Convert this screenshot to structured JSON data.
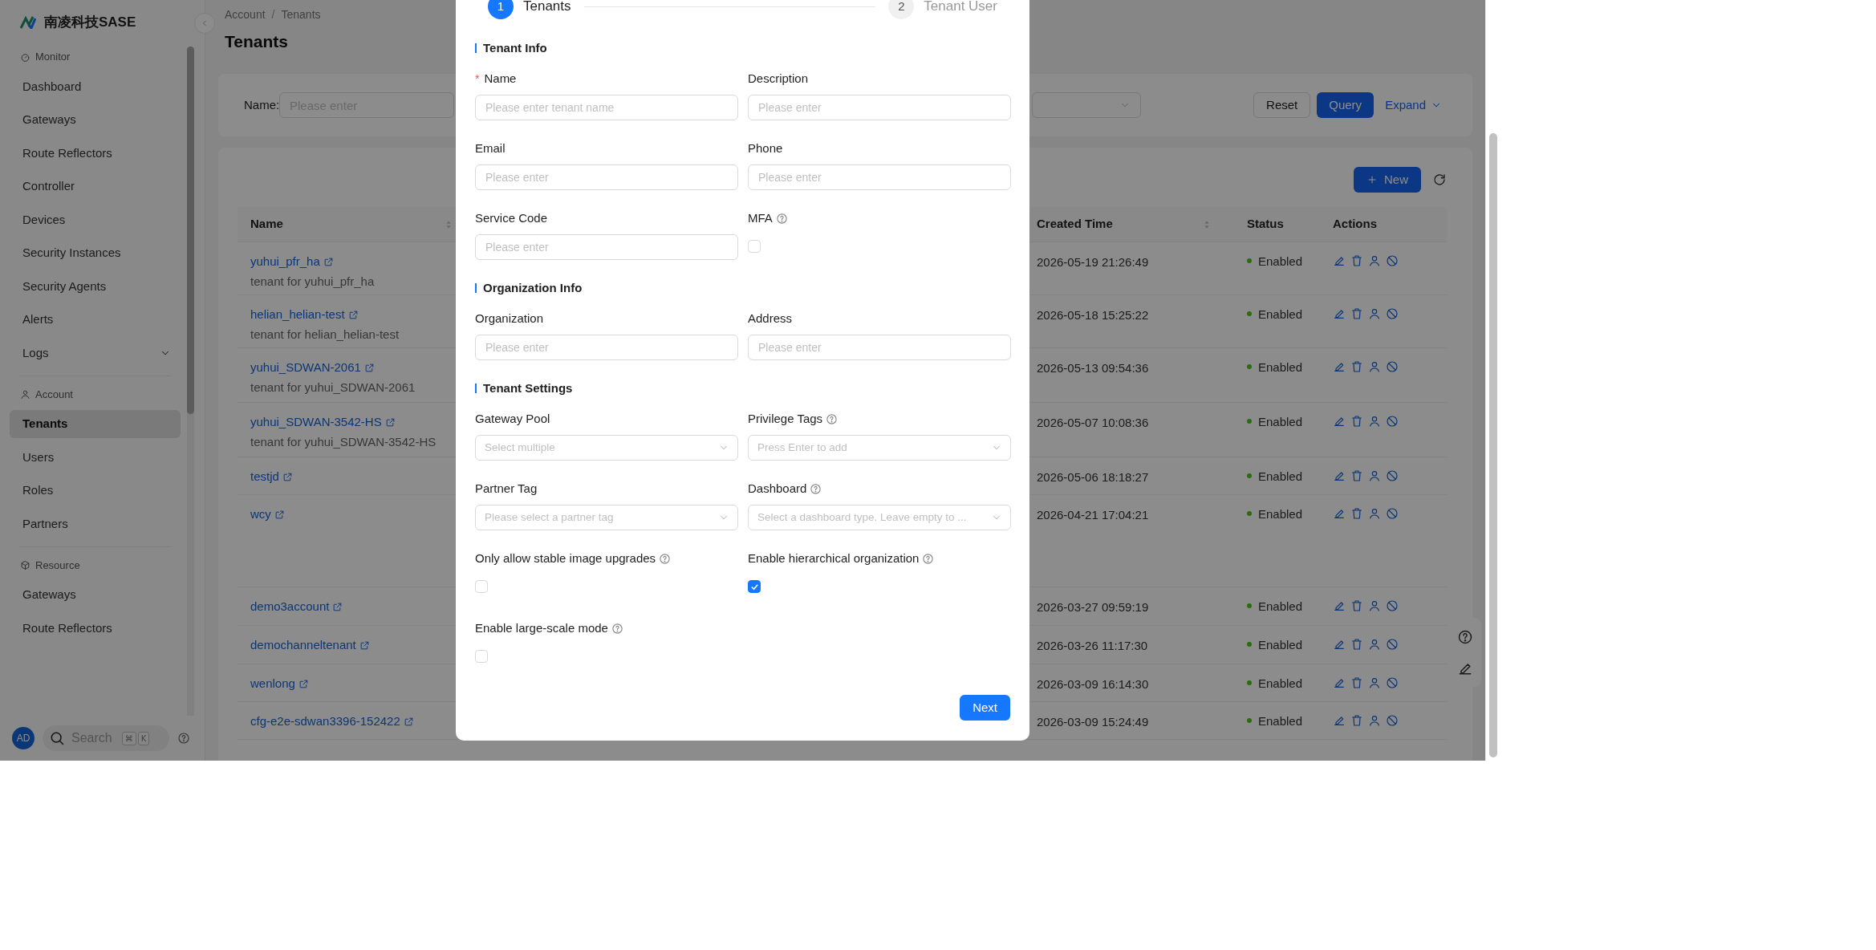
{
  "brand": "南凌科技SASE",
  "sidebar": {
    "sections": [
      {
        "title": "Monitor",
        "items": [
          {
            "label": "Dashboard",
            "kind": "link",
            "selected": false
          },
          {
            "label": "Gateways",
            "kind": "link",
            "selected": false
          },
          {
            "label": "Route Reflectors",
            "kind": "link",
            "selected": false
          },
          {
            "label": "Controller",
            "kind": "link",
            "selected": false
          },
          {
            "label": "Devices",
            "kind": "link",
            "selected": false
          },
          {
            "label": "Security Instances",
            "kind": "link",
            "selected": false
          },
          {
            "label": "Security Agents",
            "kind": "link",
            "selected": false
          },
          {
            "label": "Alerts",
            "kind": "link",
            "selected": false
          },
          {
            "label": "Logs",
            "kind": "group",
            "selected": false,
            "expanded": false
          }
        ]
      },
      {
        "title": "Account",
        "items": [
          {
            "label": "Tenants",
            "kind": "link",
            "selected": true
          },
          {
            "label": "Users",
            "kind": "link",
            "selected": false
          },
          {
            "label": "Roles",
            "kind": "link",
            "selected": false
          },
          {
            "label": "Partners",
            "kind": "link",
            "selected": false
          }
        ]
      },
      {
        "title": "Resource",
        "items": [
          {
            "label": "Gateways",
            "kind": "link",
            "selected": false
          },
          {
            "label": "Route Reflectors",
            "kind": "link",
            "selected": false
          }
        ]
      }
    ]
  },
  "user": {
    "initials": "AD"
  },
  "search": {
    "placeholder": "Search",
    "keys": [
      "⌘",
      "K"
    ]
  },
  "breadcrumb": [
    "Account",
    "Tenants"
  ],
  "breadcrumb_separator": "/",
  "page_title": "Tenants",
  "filter": {
    "label": "Name:",
    "placeholder": "Please enter",
    "reset": "Reset",
    "query": "Query",
    "expand": "Expand"
  },
  "new_button": "New",
  "table": {
    "columns": [
      {
        "label": "Name",
        "sortable": true
      },
      {
        "label": "Created Time",
        "sortable": true
      },
      {
        "label": "Status",
        "sortable": false
      },
      {
        "label": "Actions",
        "sortable": false
      }
    ],
    "rows": [
      {
        "name": "yuhui_pfr_ha",
        "description": "tenant for yuhui_pfr_ha",
        "created": "2026-05-19 21:26:49",
        "status": "Enabled"
      },
      {
        "name": "helian_helian-test",
        "description": "tenant for helian_helian-test",
        "created": "2026-05-18 15:25:22",
        "status": "Enabled"
      },
      {
        "name": "yuhui_SDWAN-2061",
        "description": "tenant for yuhui_SDWAN-2061",
        "created": "2026-05-13 09:54:36",
        "status": "Enabled"
      },
      {
        "name": "yuhui_SDWAN-3542-HS",
        "description": "tenant for yuhui_SDWAN-3542-HS",
        "created": "2026-05-07 10:08:36",
        "status": "Enabled"
      },
      {
        "name": "testjd",
        "created": "2026-05-06 18:18:27",
        "status": "Enabled"
      },
      {
        "name": "wcy",
        "created": "2026-04-21 17:04:21",
        "status": "Enabled"
      },
      {
        "name": "demo3account",
        "created": "2026-03-27 09:59:19",
        "status": "Enabled"
      },
      {
        "name": "demochanneltenant",
        "created": "2026-03-26 11:17:30",
        "status": "Enabled"
      },
      {
        "name": "wenlong",
        "created": "2026-03-09 16:14:30",
        "status": "Enabled"
      },
      {
        "name": "cfg-e2e-sdwan3396-152422",
        "created": "2026-03-09 15:24:49",
        "status": "Enabled"
      }
    ]
  },
  "modal": {
    "steps": [
      {
        "number": "1",
        "label": "Tenants",
        "selected": true
      },
      {
        "number": "2",
        "label": "Tenant User",
        "selected": false
      }
    ],
    "sections": [
      {
        "title": "Tenant Info",
        "fields": [
          {
            "label": "Name",
            "kind": "text",
            "required": true,
            "help": false,
            "placeholder": "Please enter tenant name"
          },
          {
            "label": "Description",
            "kind": "text",
            "required": false,
            "help": false,
            "placeholder": "Please enter"
          },
          {
            "label": "Email",
            "kind": "text",
            "required": false,
            "help": false,
            "placeholder": "Please enter"
          },
          {
            "label": "Phone",
            "kind": "text",
            "required": false,
            "help": false,
            "placeholder": "Please enter"
          },
          {
            "label": "Service Code",
            "kind": "text",
            "required": false,
            "help": false,
            "placeholder": "Please enter"
          },
          {
            "label": "MFA",
            "kind": "checkbox",
            "required": false,
            "help": true,
            "checked": false
          }
        ]
      },
      {
        "title": "Organization Info",
        "fields": [
          {
            "label": "Organization",
            "kind": "text",
            "required": false,
            "help": false,
            "placeholder": "Please enter"
          },
          {
            "label": "Address",
            "kind": "text",
            "required": false,
            "help": false,
            "placeholder": "Please enter"
          }
        ]
      },
      {
        "title": "Tenant Settings",
        "fields": [
          {
            "label": "Gateway Pool",
            "kind": "select",
            "required": false,
            "help": false,
            "placeholder": "Select multiple"
          },
          {
            "label": "Privilege Tags",
            "kind": "select",
            "required": false,
            "help": true,
            "placeholder": "Press Enter to add"
          },
          {
            "label": "Partner Tag",
            "kind": "select",
            "required": false,
            "help": false,
            "placeholder": "Please select a partner tag"
          },
          {
            "label": "Dashboard",
            "kind": "select",
            "required": false,
            "help": true,
            "placeholder": "Select a dashboard type. Leave empty to ..."
          },
          {
            "label": "Only allow stable image upgrades",
            "kind": "checkbox",
            "required": false,
            "help": true,
            "checked": false
          },
          {
            "label": "Enable hierarchical organization",
            "kind": "checkbox",
            "required": false,
            "help": true,
            "checked": true
          },
          {
            "label": "Enable large-scale mode",
            "kind": "checkbox",
            "required": false,
            "help": true,
            "checked": false
          }
        ]
      }
    ],
    "required_mark": "*",
    "next": "Next"
  }
}
